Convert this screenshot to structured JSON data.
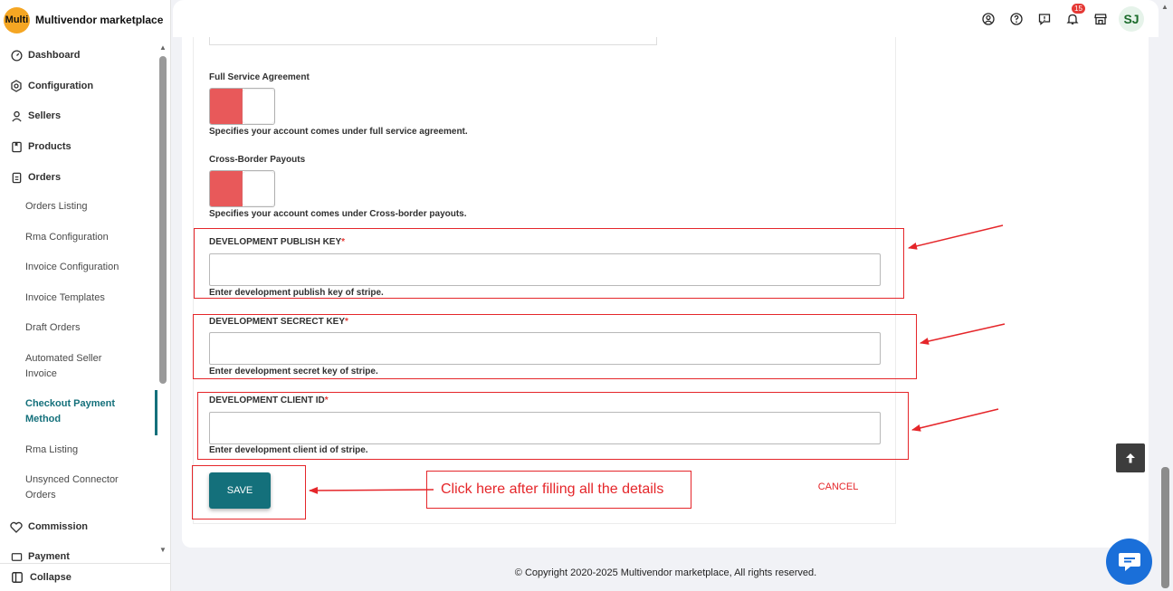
{
  "brand": {
    "logo_text": "Multi",
    "name": "Multivendor marketplace"
  },
  "sidebar": {
    "items": [
      {
        "label": "Dashboard",
        "icon": "dashboard-icon"
      },
      {
        "label": "Configuration",
        "icon": "gear-icon"
      },
      {
        "label": "Sellers",
        "icon": "person-icon"
      },
      {
        "label": "Products",
        "icon": "tag-icon"
      },
      {
        "label": "Orders",
        "icon": "orders-icon"
      }
    ],
    "subitems": [
      {
        "label": "Orders Listing"
      },
      {
        "label": "Rma Configuration"
      },
      {
        "label": "Invoice Configuration"
      },
      {
        "label": "Invoice Templates"
      },
      {
        "label": "Draft Orders"
      },
      {
        "label": "Automated Seller Invoice"
      },
      {
        "label": "Checkout Payment Method",
        "active": true
      },
      {
        "label": "Rma Listing"
      },
      {
        "label": "Unsynced Connector Orders"
      }
    ],
    "bottom_items": [
      {
        "label": "Commission",
        "icon": "commission-icon"
      },
      {
        "label": "Payment",
        "icon": "payment-icon"
      }
    ],
    "collapse_label": "Collapse"
  },
  "topbar": {
    "icons": [
      "account-icon",
      "help-icon",
      "feedback-icon",
      "bell-icon",
      "store-icon"
    ],
    "notification_count": "15",
    "avatar_initials": "SJ"
  },
  "form": {
    "full_service": {
      "label": "Full Service Agreement",
      "help": "Specifies your account comes under full service agreement.",
      "enabled": true
    },
    "cross_border": {
      "label": "Cross-Border Payouts",
      "help": "Specifies your account comes under Cross-border payouts.",
      "enabled": true
    },
    "publish_key": {
      "label": "DEVELOPMENT PUBLISH KEY",
      "required_mark": "*",
      "value": "",
      "help": "Enter development publish key of stripe."
    },
    "secret_key": {
      "label": "DEVELOPMENT SECRECT KEY",
      "required_mark": "*",
      "value": "",
      "help": "Enter development secret key of stripe."
    },
    "client_id": {
      "label": "DEVELOPMENT CLIENT ID",
      "required_mark": "*",
      "value": "",
      "help": "Enter development client id of stripe."
    },
    "save_label": "SAVE",
    "cancel_label": "CANCEL"
  },
  "annotation": {
    "callout_text": "Click here after filling all the details",
    "color": "#e5262a"
  },
  "footer": {
    "copyright": "© Copyright 2020-2025 Multivendor marketplace, All rights reserved."
  },
  "colors": {
    "accent": "#14707b",
    "toggle_on": "#e8595a",
    "chat": "#1a6fd9"
  }
}
